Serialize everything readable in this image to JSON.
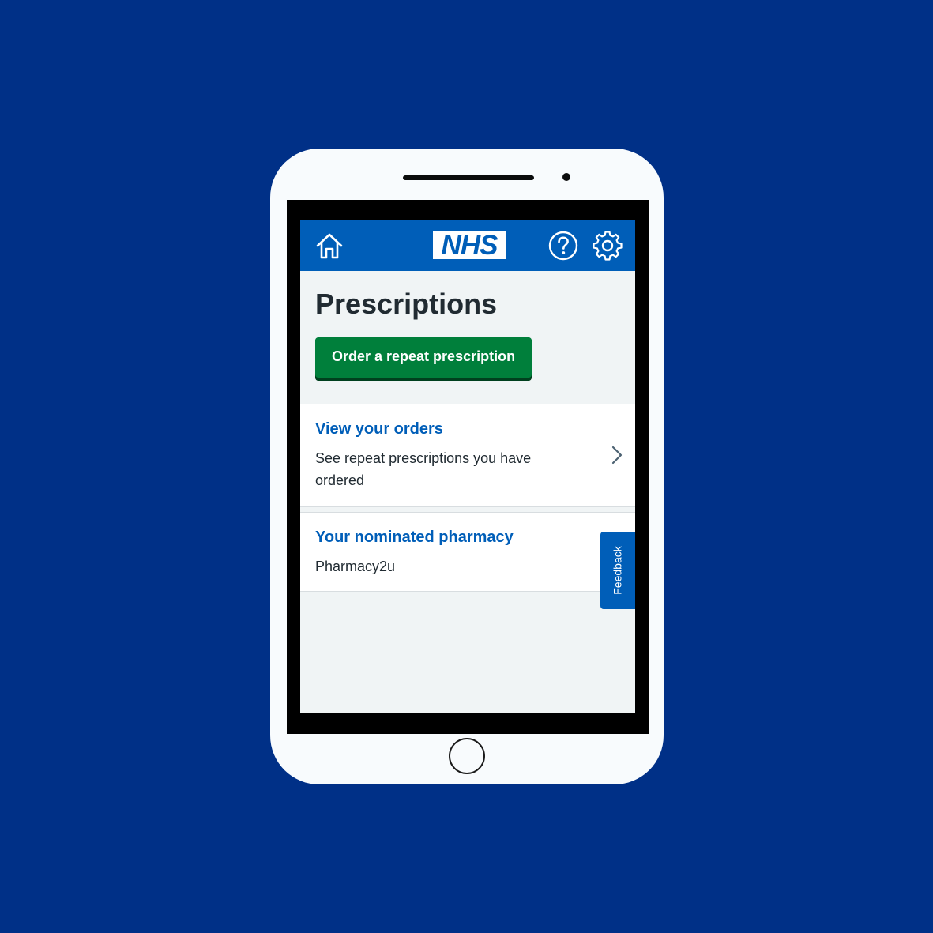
{
  "colors": {
    "background": "#003087",
    "header": "#005eb8",
    "primary_button": "#007f3b",
    "link": "#005eb8",
    "text": "#212b32",
    "page_bg": "#f0f4f5"
  },
  "header": {
    "home_icon": "home-icon",
    "logo_text": "NHS",
    "help_icon": "help-icon",
    "settings_icon": "gear-icon"
  },
  "page": {
    "title": "Prescriptions",
    "order_button_label": "Order a repeat prescription"
  },
  "cards": [
    {
      "title": "View your orders",
      "description": "See repeat prescriptions you have ordered",
      "icon": "chevron-right-icon"
    },
    {
      "title": "Your nominated pharmacy",
      "description": "Pharmacy2u"
    }
  ],
  "feedback_tab": {
    "label": "Feedback"
  }
}
